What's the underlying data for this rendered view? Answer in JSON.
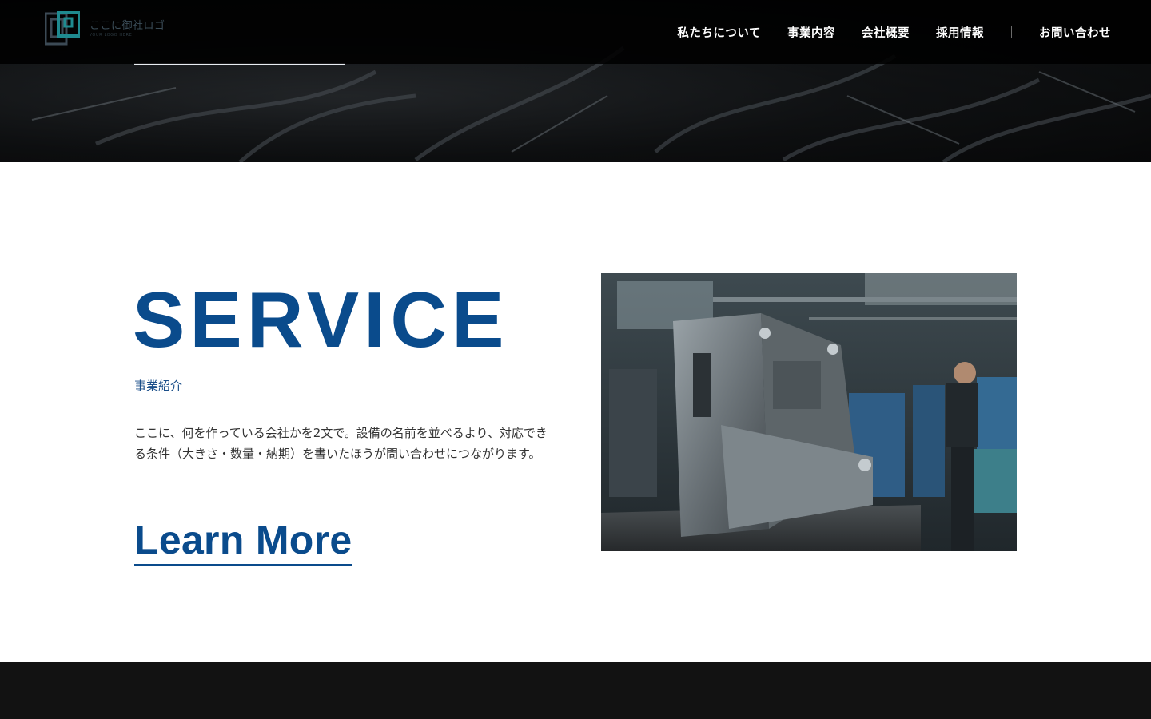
{
  "brand": {
    "logo_text": "ここに御社ロゴ",
    "logo_subtext": "YOUR LOGO HERE"
  },
  "nav": {
    "items": [
      "私たちについて",
      "事業内容",
      "会社概要",
      "採用情報"
    ],
    "contact": "お問い合わせ"
  },
  "service": {
    "title": "SERVICE",
    "subtitle": "事業紹介",
    "description": "ここに、何を作っている会社かを2文で。設備の名前を並べるより、対応できる条件（大きさ・数量・納期）を書いたほうが問い合わせにつながります。",
    "cta": "Learn More"
  },
  "colors": {
    "accent": "#0a4b8c",
    "header_bg": "#000000",
    "footer_bg": "#121212"
  }
}
